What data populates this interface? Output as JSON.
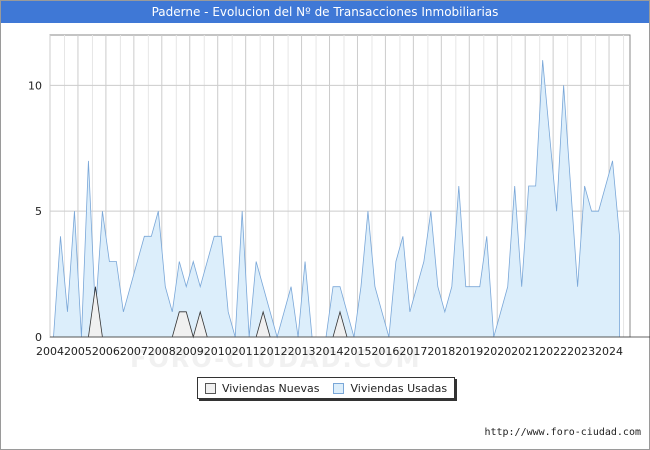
{
  "title": "Paderne - Evolucion del Nº de Transacciones Inmobiliarias",
  "watermark": "FORO-CIUDAD.COM",
  "source": "http://www.foro-ciudad.com",
  "colors": {
    "title_bg": "#3f78d6",
    "usadas_fill": "#dceefb",
    "usadas_line": "#7aa7d8",
    "nuevas_fill": "#f0f0f0",
    "nuevas_line": "#333333",
    "grid": "#cccccc"
  },
  "chart_data": {
    "type": "area",
    "title": "Paderne - Evolucion del Nº de Transacciones Inmobiliarias",
    "xlabel": "",
    "ylabel": "",
    "x_ticks": [
      "2004",
      "2005",
      "2006",
      "2007",
      "2008",
      "2009",
      "2010",
      "2011",
      "2012",
      "2013",
      "2014",
      "2015",
      "2016",
      "2017",
      "2018",
      "2019",
      "2020",
      "2021",
      "2022",
      "2023",
      "2024"
    ],
    "y_ticks": [
      0,
      5,
      10
    ],
    "xlim": [
      2004,
      2024.75
    ],
    "ylim": [
      0,
      12
    ],
    "grid": true,
    "legend_position": "bottom",
    "x_period": "quarterly",
    "series": [
      {
        "name": "Viviendas Nuevas",
        "values": [
          0,
          0,
          0,
          0,
          0,
          0,
          2,
          0,
          0,
          0,
          0,
          0,
          0,
          0,
          0,
          0,
          0,
          0,
          1,
          1,
          0,
          1,
          0,
          0,
          0,
          0,
          0,
          0,
          0,
          0,
          1,
          0,
          0,
          0,
          0,
          0,
          0,
          0,
          0,
          0,
          0,
          1,
          0,
          0,
          0,
          0,
          0,
          0,
          0,
          0,
          0,
          0,
          0,
          0,
          0,
          0,
          0,
          0,
          0,
          0,
          0,
          0,
          0,
          0,
          0,
          0,
          0,
          0,
          0,
          0,
          0,
          0,
          0,
          0,
          0,
          0,
          0,
          0,
          0,
          0,
          0,
          0,
          0,
          0,
          0,
          0,
          0,
          0,
          0,
          0,
          0,
          0,
          0,
          0,
          0,
          0,
          0,
          0,
          0,
          0
        ]
      },
      {
        "name": "Viviendas Usadas",
        "values": [
          0,
          4,
          1,
          5,
          0,
          7,
          1,
          5,
          3,
          3,
          1,
          2,
          3,
          4,
          4,
          5,
          2,
          1,
          3,
          2,
          3,
          2,
          3,
          4,
          4,
          1,
          0,
          5,
          0,
          3,
          2,
          1,
          0,
          1,
          2,
          0,
          3,
          0,
          0,
          0,
          2,
          2,
          1,
          0,
          2,
          5,
          2,
          1,
          0,
          3,
          4,
          1,
          2,
          3,
          5,
          2,
          1,
          2,
          6,
          2,
          2,
          2,
          4,
          0,
          1,
          2,
          6,
          2,
          6,
          6,
          11,
          8,
          5,
          10,
          6,
          2,
          6,
          5,
          5,
          6,
          7,
          4
        ]
      }
    ]
  }
}
